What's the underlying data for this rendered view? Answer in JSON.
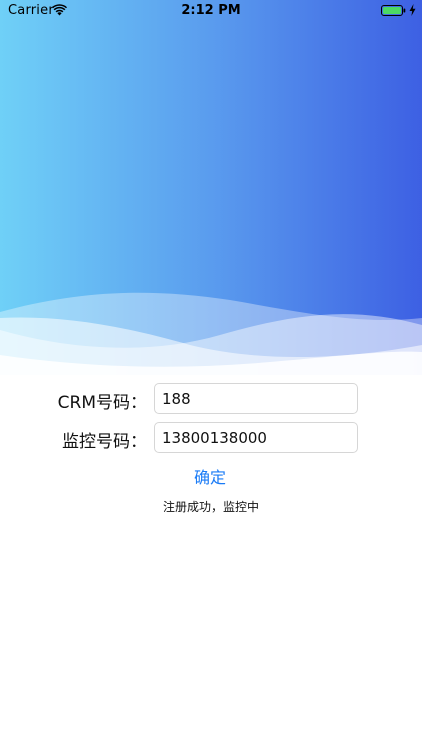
{
  "status_bar": {
    "carrier": "Carrier",
    "time": "2:12 PM",
    "icons": [
      "wifi-icon",
      "battery-icon",
      "charging-bolt-icon"
    ]
  },
  "colors": {
    "gradient_start": "#6fd0f7",
    "gradient_end": "#3d60e3",
    "accent": "#1a7bf6",
    "battery": "#4cd964"
  },
  "form": {
    "crm_label": "CRM号码：",
    "crm_value": "188",
    "monitor_label": "监控号码：",
    "monitor_value": "13800138000",
    "confirm_label": "确定"
  },
  "status_message": "注册成功，监控中"
}
